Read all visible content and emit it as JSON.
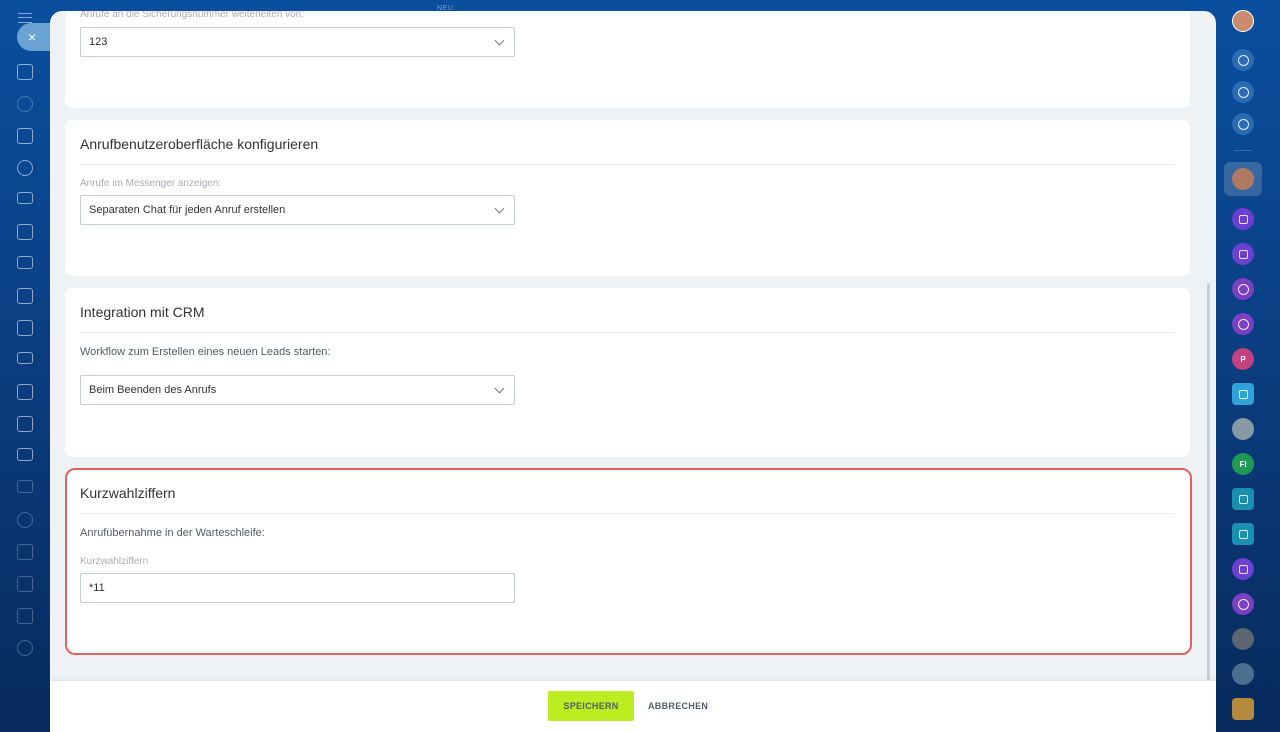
{
  "top_badge": "NEU",
  "close_glyph": "×",
  "cards": {
    "forwarding": {
      "label": "Anrufe an die Sicherungsnummer weiterleiten von:",
      "value": "123"
    },
    "call_ui": {
      "title": "Anrufbenutzeroberfläche konfigurieren",
      "label": "Anrufe im Messenger anzeigen:",
      "value": "Separaten Chat für jeden Anruf erstellen"
    },
    "crm": {
      "title": "Integration mit CRM",
      "label": "Workflow zum Erstellen eines neuen Leads starten:",
      "value": "Beim Beenden des Anrufs"
    },
    "speed_dial": {
      "title": "Kurzwahlziffern",
      "subtitle": "Anrufübernahme in der Warteschleife:",
      "field_label": "Kurzwahlziffern",
      "value": "*11"
    }
  },
  "footer": {
    "save_label": "SPEICHERN",
    "cancel_label": "ABBRECHEN"
  },
  "right_sidebar": {
    "avatar_initials": [
      "P",
      "FI"
    ]
  },
  "colors": {
    "accent_save": "#bbed21",
    "highlight_border": "#e3625e",
    "background_blue": "#0a4f9e"
  },
  "icons": {
    "left_sidebar": [
      "menu-icon",
      "home-icon",
      "feed-icon",
      "document-icon",
      "contacts-icon",
      "inbox-icon",
      "tasks-icon",
      "mail-icon",
      "calendar-icon",
      "chat-icon",
      "filter-icon",
      "sign-icon",
      "store-icon",
      "screen-icon",
      "cart-icon",
      "target-icon",
      "cube-icon",
      "analytics-icon",
      "table-icon",
      "help-icon"
    ],
    "right_sidebar": [
      "user-avatar",
      "bell-icon",
      "target-icon",
      "search-chat-icon"
    ]
  }
}
